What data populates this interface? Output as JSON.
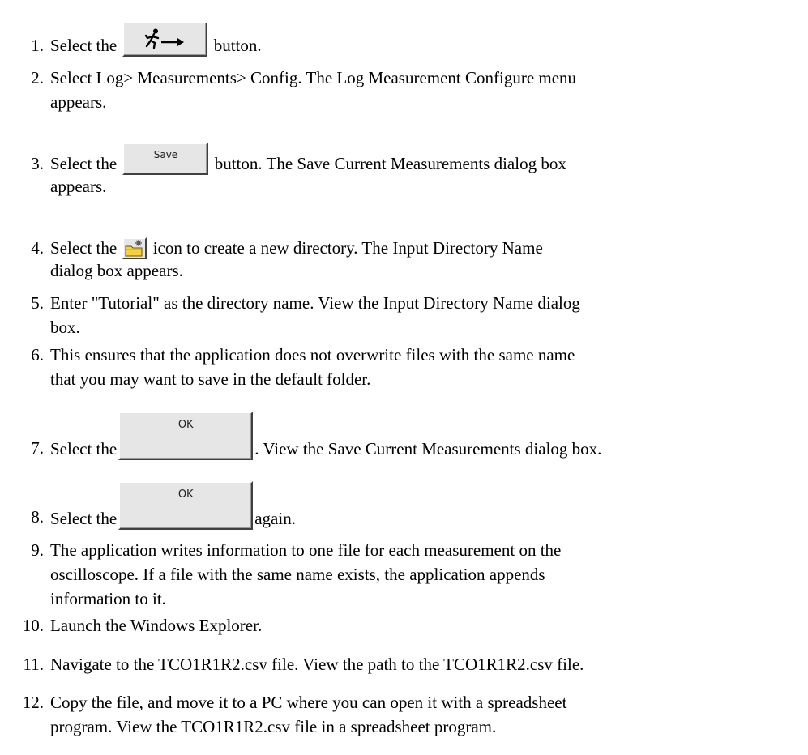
{
  "steps": [
    {
      "num": "1.",
      "before": "Select the",
      "button_icon": "run-arrow-icon",
      "after": "button."
    },
    {
      "num": "2.",
      "line1": "Select Log> Measurements> Config. The Log Measurement Configure menu",
      "line2": "appears."
    },
    {
      "num": "3.",
      "before": "Select the",
      "button_label": "Save",
      "after": "button. The Save Current Measurements dialog box",
      "line2": "appears."
    },
    {
      "num": "4.",
      "before": "Select the",
      "icon": "new-folder-icon",
      "after": "icon to create a new directory. The Input Directory Name",
      "line2": "dialog box appears."
    },
    {
      "num": "5.",
      "line1": "Enter \"Tutorial\" as the directory name. View the Input Directory Name dialog",
      "line2": "box."
    },
    {
      "num": "6.",
      "line1": "This ensures that the application does not overwrite files with the same name",
      "line2": "that you may want to save in the default folder."
    },
    {
      "num": "7.",
      "before": "Select the",
      "button_label": "OK",
      "after": ". View the Save Current Measurements dialog box."
    },
    {
      "num": "8.",
      "before": "Select the",
      "button_label": "OK",
      "after": "again."
    },
    {
      "num": "9.",
      "line1": "The application writes information to one file for each measurement on the",
      "line2": "oscilloscope. If a file with the same name exists, the application appends",
      "line3": "information to it."
    },
    {
      "num": "10.",
      "line1": "Launch the Windows Explorer."
    },
    {
      "num": "11.",
      "line1": "Navigate to the TCO1R1R2.csv file. View the path to the TCO1R1R2.csv file."
    },
    {
      "num": "12.",
      "line1": "Copy the file, and move it to a PC where you can open it with a spreadsheet",
      "line2": "program. View the TCO1R1R2.csv file in a spreadsheet program."
    }
  ]
}
